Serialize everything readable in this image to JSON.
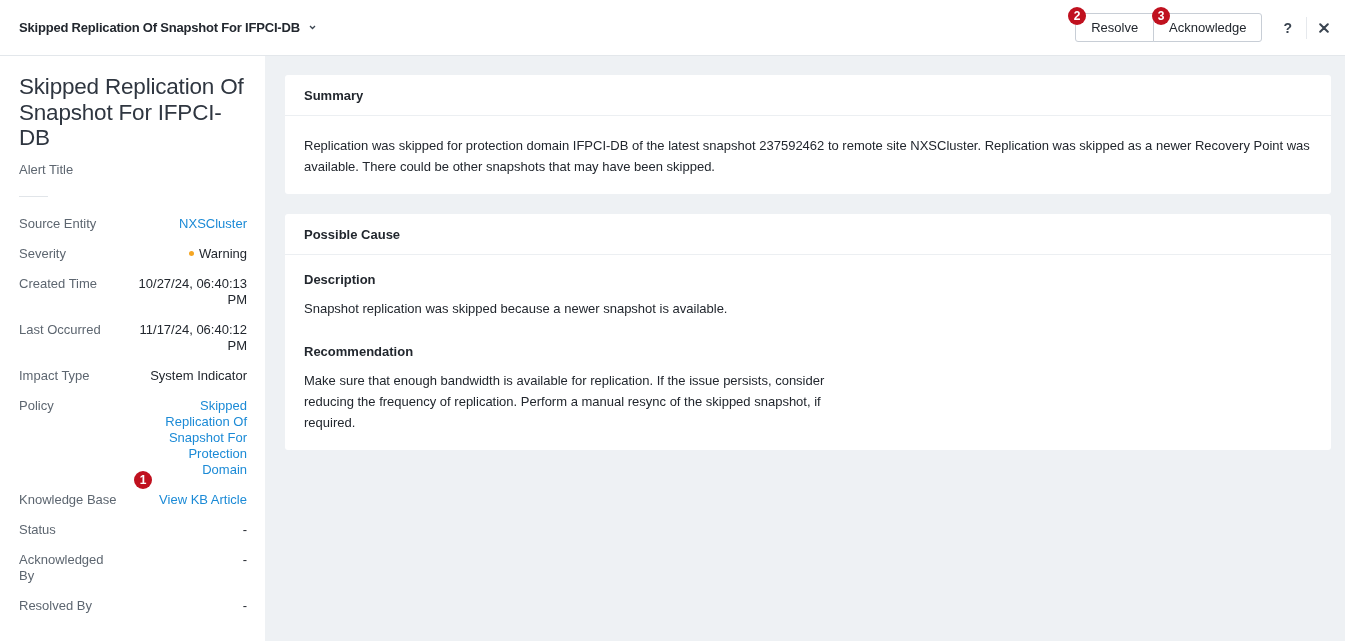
{
  "header": {
    "title": "Skipped Replication Of Snapshot For IFPCI-DB",
    "actions": [
      {
        "label": "Resolve",
        "marker": "2"
      },
      {
        "label": "Acknowledge",
        "marker": "3"
      }
    ],
    "help": "?"
  },
  "sidebar": {
    "title": "Skipped Replication Of Snapshot For IFPCI-DB",
    "subtitle": "Alert Title",
    "fields": [
      {
        "label": "Source Entity",
        "value": "NXSCluster",
        "kind": "link"
      },
      {
        "label": "Severity",
        "value": "Warning",
        "kind": "status",
        "color": "#f5a623"
      },
      {
        "label": "Created Time",
        "value": "10/27/24, 06:40:13 PM",
        "kind": "text"
      },
      {
        "label": "Last Occurred",
        "value": "11/17/24, 06:40:12 PM",
        "kind": "text"
      },
      {
        "label": "Impact Type",
        "value": "System Indicator",
        "kind": "text"
      },
      {
        "label": "Policy",
        "value": "Skipped Replication Of Snapshot For Protection Domain",
        "kind": "link"
      },
      {
        "label": "Knowledge Base",
        "value": "View KB Article",
        "kind": "link",
        "marker": "1"
      },
      {
        "label": "Status",
        "value": "-",
        "kind": "text"
      },
      {
        "label": "Acknowledged By",
        "value": "-",
        "kind": "text"
      },
      {
        "label": "Resolved By",
        "value": "-",
        "kind": "text"
      }
    ]
  },
  "cards": [
    {
      "title": "Summary",
      "sections": [
        {
          "text": "Replication was skipped for protection domain IFPCI-DB of the latest snapshot 237592462 to remote site NXSCluster. Replication was skipped as a newer Recovery Point was available. There could be other snapshots that may have been skipped."
        }
      ]
    },
    {
      "title": "Possible Cause",
      "sections": [
        {
          "heading": "Description",
          "text": "Snapshot replication was skipped because a newer snapshot is available."
        },
        {
          "heading": "Recommendation",
          "text": "Make sure that enough bandwidth is available for replication. If the issue persists, consider reducing the frequency of replication. Perform a manual resync of the skipped snapshot, if required."
        }
      ]
    }
  ]
}
